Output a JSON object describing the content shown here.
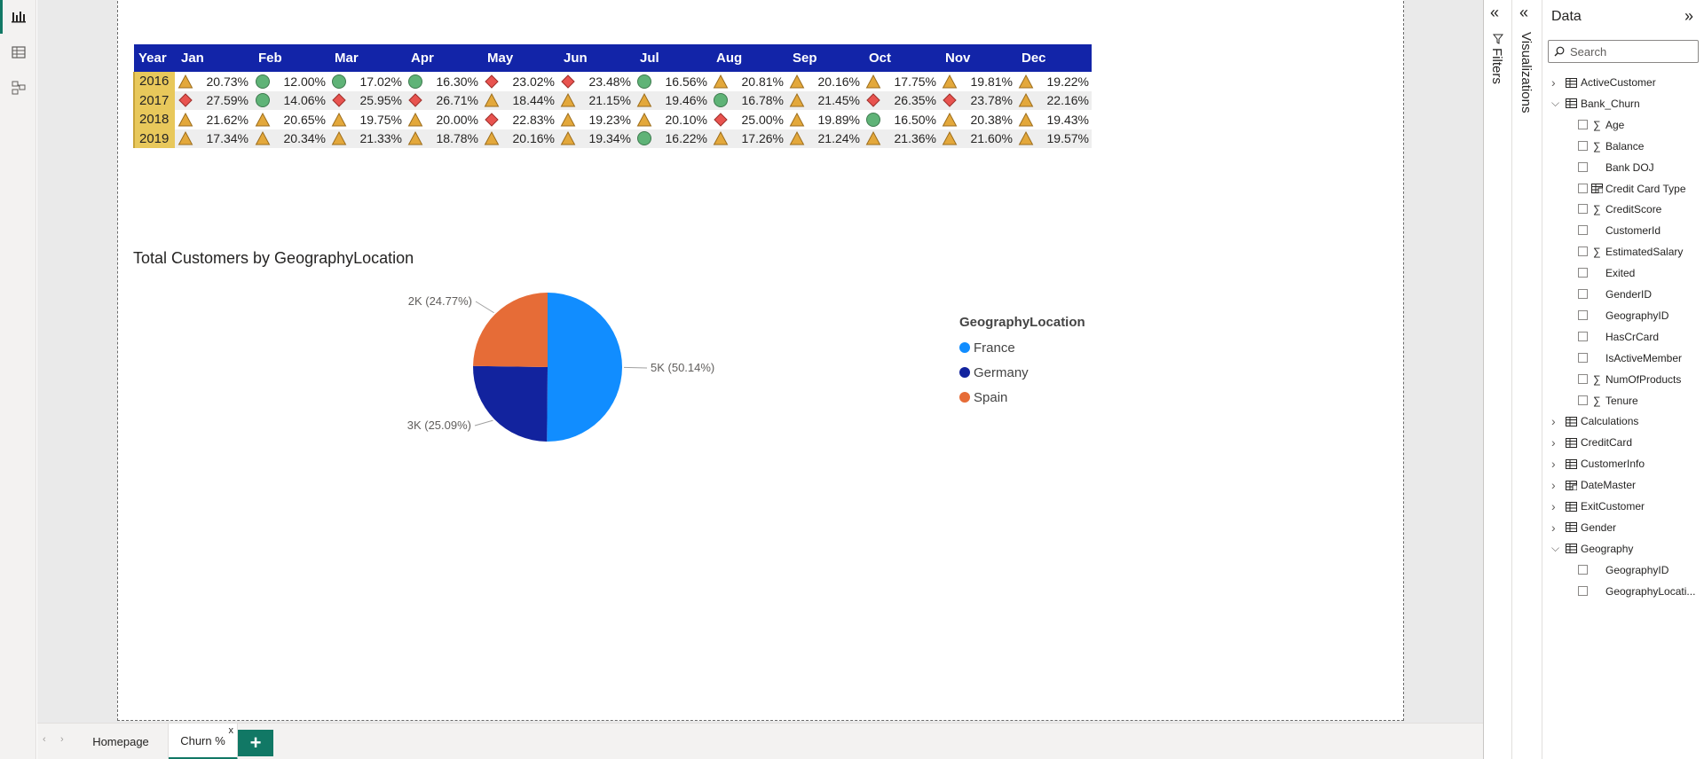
{
  "matrix": {
    "headers": [
      "Year",
      "Jan",
      "Feb",
      "Mar",
      "Apr",
      "May",
      "Jun",
      "Jul",
      "Aug",
      "Sep",
      "Oct",
      "Nov",
      "Dec"
    ],
    "rows": [
      {
        "year": "2016",
        "cells": [
          {
            "v": "20.73%",
            "icon": "warning-triangle"
          },
          {
            "v": "12.00%",
            "icon": "good-circle"
          },
          {
            "v": "17.02%",
            "icon": "good-circle"
          },
          {
            "v": "16.30%",
            "icon": "good-circle"
          },
          {
            "v": "23.02%",
            "icon": "bad-diamond"
          },
          {
            "v": "23.48%",
            "icon": "bad-diamond"
          },
          {
            "v": "16.56%",
            "icon": "good-circle"
          },
          {
            "v": "20.81%",
            "icon": "warning-triangle"
          },
          {
            "v": "20.16%",
            "icon": "warning-triangle"
          },
          {
            "v": "17.75%",
            "icon": "warning-triangle"
          },
          {
            "v": "19.81%",
            "icon": "warning-triangle"
          },
          {
            "v": "19.22%",
            "icon": "warning-triangle"
          }
        ]
      },
      {
        "year": "2017",
        "cells": [
          {
            "v": "27.59%",
            "icon": "bad-diamond"
          },
          {
            "v": "14.06%",
            "icon": "good-circle"
          },
          {
            "v": "25.95%",
            "icon": "bad-diamond"
          },
          {
            "v": "26.71%",
            "icon": "bad-diamond"
          },
          {
            "v": "18.44%",
            "icon": "warning-triangle"
          },
          {
            "v": "21.15%",
            "icon": "warning-triangle"
          },
          {
            "v": "19.46%",
            "icon": "warning-triangle"
          },
          {
            "v": "16.78%",
            "icon": "good-circle"
          },
          {
            "v": "21.45%",
            "icon": "warning-triangle"
          },
          {
            "v": "26.35%",
            "icon": "bad-diamond"
          },
          {
            "v": "23.78%",
            "icon": "bad-diamond"
          },
          {
            "v": "22.16%",
            "icon": "warning-triangle"
          }
        ]
      },
      {
        "year": "2018",
        "cells": [
          {
            "v": "21.62%",
            "icon": "warning-triangle"
          },
          {
            "v": "20.65%",
            "icon": "warning-triangle"
          },
          {
            "v": "19.75%",
            "icon": "warning-triangle"
          },
          {
            "v": "20.00%",
            "icon": "warning-triangle"
          },
          {
            "v": "22.83%",
            "icon": "bad-diamond"
          },
          {
            "v": "19.23%",
            "icon": "warning-triangle"
          },
          {
            "v": "20.10%",
            "icon": "warning-triangle"
          },
          {
            "v": "25.00%",
            "icon": "bad-diamond"
          },
          {
            "v": "19.89%",
            "icon": "warning-triangle"
          },
          {
            "v": "16.50%",
            "icon": "good-circle"
          },
          {
            "v": "20.38%",
            "icon": "warning-triangle"
          },
          {
            "v": "19.43%",
            "icon": "warning-triangle"
          }
        ]
      },
      {
        "year": "2019",
        "cells": [
          {
            "v": "17.34%",
            "icon": "warning-triangle"
          },
          {
            "v": "20.34%",
            "icon": "warning-triangle"
          },
          {
            "v": "21.33%",
            "icon": "warning-triangle"
          },
          {
            "v": "18.78%",
            "icon": "warning-triangle"
          },
          {
            "v": "20.16%",
            "icon": "warning-triangle"
          },
          {
            "v": "19.34%",
            "icon": "warning-triangle"
          },
          {
            "v": "16.22%",
            "icon": "good-circle"
          },
          {
            "v": "17.26%",
            "icon": "warning-triangle"
          },
          {
            "v": "21.24%",
            "icon": "warning-triangle"
          },
          {
            "v": "21.36%",
            "icon": "warning-triangle"
          },
          {
            "v": "21.60%",
            "icon": "warning-triangle"
          },
          {
            "v": "19.57%",
            "icon": "warning-triangle"
          }
        ]
      }
    ],
    "colors": {
      "header_bg": "#1224a8",
      "year_bg": "#e8c85b",
      "good": "#5fb377",
      "warning": "#e3a83b",
      "bad": "#e8534f"
    }
  },
  "chart_data": {
    "type": "pie",
    "title": "Total Customers by GeographyLocation",
    "legend_title": "GeographyLocation",
    "legend_position": "right",
    "slices": [
      {
        "name": "France",
        "value": 50.14,
        "label": "5K (50.14%)",
        "color": "#118dff"
      },
      {
        "name": "Germany",
        "value": 25.09,
        "label": "3K (25.09%)",
        "color": "#12239e"
      },
      {
        "name": "Spain",
        "value": 24.77,
        "label": "2K (24.77%)",
        "color": "#e66c37"
      }
    ]
  },
  "tabs": {
    "pages": [
      "Homepage",
      "Churn %"
    ],
    "active": "Churn %",
    "close_glyph": "x",
    "add_glyph": "+"
  },
  "panes": {
    "filters_label": "Filters",
    "visualizations_label": "Visualizations",
    "data_title": "Data",
    "search_placeholder": "Search"
  },
  "data_tree": [
    {
      "label": "ActiveCustomer",
      "kind": "table",
      "expanded": false
    },
    {
      "label": "Bank_Churn",
      "kind": "table",
      "expanded": true
    },
    {
      "label": "Age",
      "kind": "field",
      "sigma": true
    },
    {
      "label": "Balance",
      "kind": "field",
      "sigma": true
    },
    {
      "label": "Bank DOJ",
      "kind": "field",
      "sigma": false
    },
    {
      "label": "Credit Card Type",
      "kind": "field",
      "calc": true
    },
    {
      "label": "CreditScore",
      "kind": "field",
      "sigma": true
    },
    {
      "label": "CustomerId",
      "kind": "field",
      "sigma": false
    },
    {
      "label": "EstimatedSalary",
      "kind": "field",
      "sigma": true
    },
    {
      "label": "Exited",
      "kind": "field",
      "sigma": false
    },
    {
      "label": "GenderID",
      "kind": "field",
      "sigma": false
    },
    {
      "label": "GeographyID",
      "kind": "field",
      "sigma": false
    },
    {
      "label": "HasCrCard",
      "kind": "field",
      "sigma": false
    },
    {
      "label": "IsActiveMember",
      "kind": "field",
      "sigma": false
    },
    {
      "label": "NumOfProducts",
      "kind": "field",
      "sigma": true
    },
    {
      "label": "Tenure",
      "kind": "field",
      "sigma": true
    },
    {
      "label": "Calculations",
      "kind": "table",
      "expanded": false
    },
    {
      "label": "CreditCard",
      "kind": "table",
      "expanded": false
    },
    {
      "label": "CustomerInfo",
      "kind": "table",
      "expanded": false
    },
    {
      "label": "DateMaster",
      "kind": "table",
      "expanded": false,
      "calc": true
    },
    {
      "label": "ExitCustomer",
      "kind": "table",
      "expanded": false
    },
    {
      "label": "Gender",
      "kind": "table",
      "expanded": false
    },
    {
      "label": "Geography",
      "kind": "table",
      "expanded": true
    },
    {
      "label": "GeographyID",
      "kind": "field",
      "sigma": false
    },
    {
      "label": "GeographyLocati...",
      "kind": "field",
      "sigma": false
    }
  ]
}
